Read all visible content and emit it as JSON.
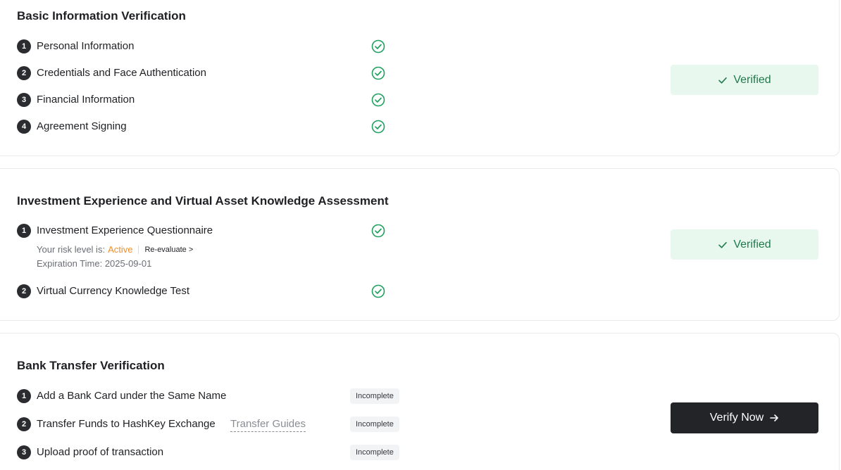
{
  "colors": {
    "success": "#1fa060",
    "verified_bg": "#e8f8ee",
    "warning": "#f0902c",
    "dark": "#232428"
  },
  "basic": {
    "title": "Basic Information Verification",
    "steps": [
      {
        "num": "1",
        "label": "Personal Information",
        "icon": "check-circle-icon"
      },
      {
        "num": "2",
        "label": "Credentials and Face Authentication",
        "icon": "check-circle-icon"
      },
      {
        "num": "3",
        "label": "Financial Information",
        "icon": "check-circle-icon"
      },
      {
        "num": "4",
        "label": "Agreement Signing",
        "icon": "check-circle-icon"
      }
    ],
    "status": "Verified"
  },
  "investment": {
    "title": "Investment Experience and Virtual Asset Knowledge Assessment",
    "steps": [
      {
        "num": "1",
        "label": "Investment Experience Questionnaire",
        "icon": "check-circle-icon"
      },
      {
        "num": "2",
        "label": "Virtual Currency Knowledge Test",
        "icon": "check-circle-icon"
      }
    ],
    "risk_prefix": "Your risk level is:",
    "risk_status": "Active",
    "reevaluate": "Re-evaluate >",
    "expiration": "Expiration Time: 2025-09-01",
    "status": "Verified"
  },
  "bank": {
    "title": "Bank Transfer Verification",
    "steps": [
      {
        "num": "1",
        "label": "Add a Bank Card under the Same Name",
        "status": "Incomplete"
      },
      {
        "num": "2",
        "label": "Transfer Funds to HashKey Exchange",
        "status": "Incomplete"
      },
      {
        "num": "3",
        "label": "Upload proof of transaction",
        "status": "Incomplete"
      }
    ],
    "guide_link": "Transfer Guides",
    "button": "Verify Now"
  }
}
